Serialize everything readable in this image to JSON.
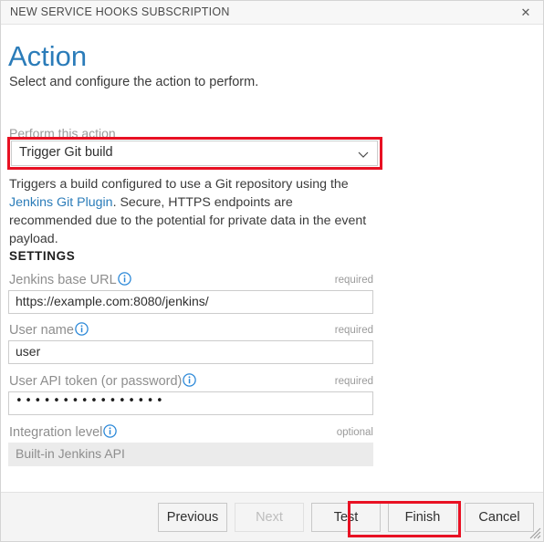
{
  "window": {
    "title": "NEW SERVICE HOOKS SUBSCRIPTION",
    "close_icon": "close-icon",
    "close_glyph": "✕",
    "resize_grip_icon": "resize-grip-icon"
  },
  "page": {
    "title": "Action",
    "subtitle": "Select and configure the action to perform.",
    "title_color": "#2b7cb9"
  },
  "action": {
    "label": "Perform this action",
    "selected": "Trigger Git build",
    "chevron_icon": "chevron-down-icon",
    "highlight_color": "#e81123",
    "description_part1": "Triggers a build configured to use a Git repository using the ",
    "description_link": "Jenkins Git Plugin",
    "description_part2": ". Secure, HTTPS endpoints are recommended due to the potential for private data in the event payload.",
    "link_color": "#2b7cb9"
  },
  "settings": {
    "heading": "SETTINGS",
    "info_icon": "info-icon",
    "fields": [
      {
        "label": "Jenkins base URL",
        "requirement": "required",
        "value": "https://example.com:8080/jenkins/",
        "disabled": false,
        "masked": false
      },
      {
        "label": "User name",
        "requirement": "required",
        "value": "user",
        "disabled": false,
        "masked": false
      },
      {
        "label": "User API token (or password)",
        "requirement": "required",
        "value": "••••••••••••••••",
        "disabled": false,
        "masked": true
      },
      {
        "label": "Integration level",
        "requirement": "optional",
        "value": "Built-in Jenkins API",
        "disabled": true,
        "masked": false
      }
    ]
  },
  "footer": {
    "buttons": [
      {
        "label": "Previous",
        "disabled": false
      },
      {
        "label": "Next",
        "disabled": true
      },
      {
        "label": "Test",
        "disabled": false
      },
      {
        "label": "Finish",
        "disabled": false
      },
      {
        "label": "Cancel",
        "disabled": false
      }
    ],
    "highlight_color": "#e81123"
  }
}
